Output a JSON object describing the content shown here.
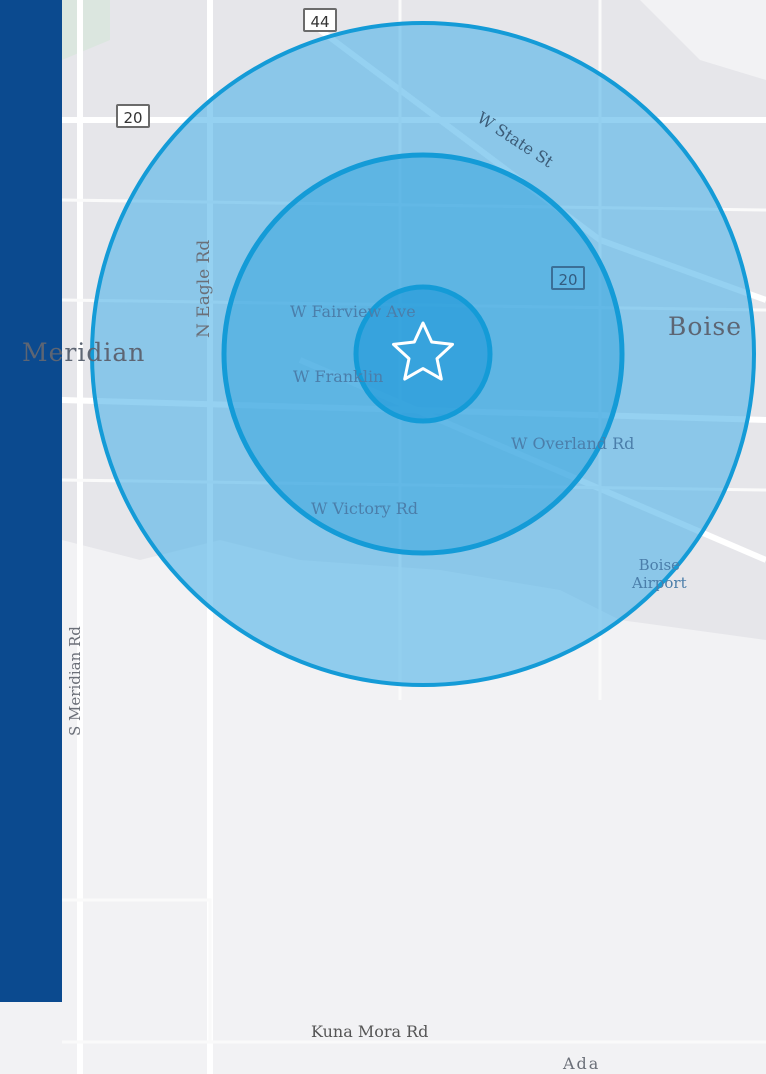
{
  "map": {
    "city_labels": {
      "meridian": "Meridian",
      "boise": "Boise",
      "ada": "Ada"
    },
    "road_labels": {
      "w_state_st": "W State St",
      "n_eagle_rd": "N Eagle Rd",
      "w_fairview_ave": "W Fairview Ave",
      "w_franklin_rd": "W Franklin",
      "w_overland_rd": "W Overland Rd",
      "w_victory_rd": "W Victory Rd",
      "s_meridian_rd": "S Meridian Rd",
      "kuna_mora_rd": "Kuna Mora Rd"
    },
    "poi_labels": {
      "boise_airport_1": "Boise",
      "boise_airport_2": "Airport"
    },
    "route_shields": {
      "us_20_top": "20",
      "us_20_inner": "20",
      "sh_44": "44"
    },
    "icons": {
      "center_marker": "star-icon"
    },
    "colors": {
      "sidebar": "#0b4a8f",
      "ring_fill": "#4fb3e8",
      "ring_stroke": "#149bd7",
      "background": "#f2f2f4"
    }
  }
}
